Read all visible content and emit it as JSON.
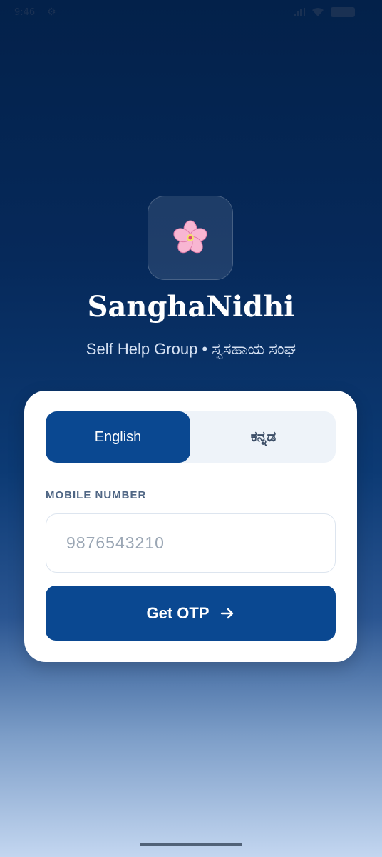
{
  "status_bar": {
    "time": "9:46",
    "icons": [
      "settings-gear-icon",
      "signal-icon",
      "wifi-icon",
      "battery-icon"
    ]
  },
  "app": {
    "logo_icon": "cherry-blossom-flower-icon",
    "name": "SanghaNidhi",
    "subtitle": "Self Help Group • ಸ್ವಸಹಾಯ ಸಂಘ"
  },
  "language_toggle": {
    "options": [
      {
        "label": "English",
        "selected": true
      },
      {
        "label": "ಕನ್ನಡ",
        "selected": false
      }
    ]
  },
  "mobile_field": {
    "label": "MOBILE NUMBER",
    "value": "",
    "placeholder": "9876543210"
  },
  "submit": {
    "label": "Get OTP",
    "icon": "arrow-right-icon"
  },
  "colors": {
    "primary": "#0a4891",
    "card": "#ffffff",
    "toggle_bg": "#eef3f9",
    "bg_top": "#03214a",
    "bg_bottom": "#c3d6f0"
  }
}
